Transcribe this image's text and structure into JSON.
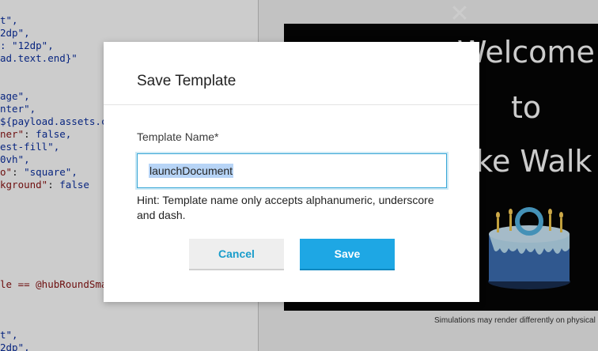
{
  "editor": {
    "lines": [
      {
        "key": "",
        "sep": "",
        "val": "t\","
      },
      {
        "key": "",
        "sep": "",
        "val": "2dp\","
      },
      {
        "key": "",
        "sep": "",
        "val": ": \"12dp\","
      },
      {
        "key": "",
        "sep": "",
        "val": "ad.text.end}\""
      },
      {
        "key": "",
        "sep": "",
        "val": "age\","
      },
      {
        "key": "",
        "sep": "",
        "val": "nter\","
      },
      {
        "key": "",
        "sep": "",
        "val": "${payload.assets.c"
      },
      {
        "key": "ner\"",
        "sep": ": ",
        "val": "false,"
      },
      {
        "key": "",
        "sep": "",
        "val": "est-fill\","
      },
      {
        "key": "",
        "sep": "",
        "val": "0vh\","
      },
      {
        "key": "o\"",
        "sep": ": ",
        "val": "\"square\","
      },
      {
        "key": "kground\"",
        "sep": ": ",
        "val": "false"
      },
      {
        "key": "",
        "sep": "",
        "val": "le == @hubRoundSma"
      },
      {
        "key": "",
        "sep": "",
        "val": "t\","
      },
      {
        "key": "",
        "sep": "",
        "val": "2dp\","
      }
    ]
  },
  "preview": {
    "welcome_lines": [
      "Welcome",
      "to",
      "ake Walk"
    ],
    "close_glyph": "✕",
    "simulation_note": "Simulations may render differently on physical d"
  },
  "dialog": {
    "title": "Save Template",
    "field_label": "Template Name*",
    "input_value": "launchDocument",
    "hint": "Hint: Template name only accepts alphanumeric, underscore and dash.",
    "cancel_label": "Cancel",
    "save_label": "Save"
  },
  "colors": {
    "accent": "#1ea7e4",
    "input_focus": "#39a7d7",
    "selection": "#b7d4f6"
  }
}
